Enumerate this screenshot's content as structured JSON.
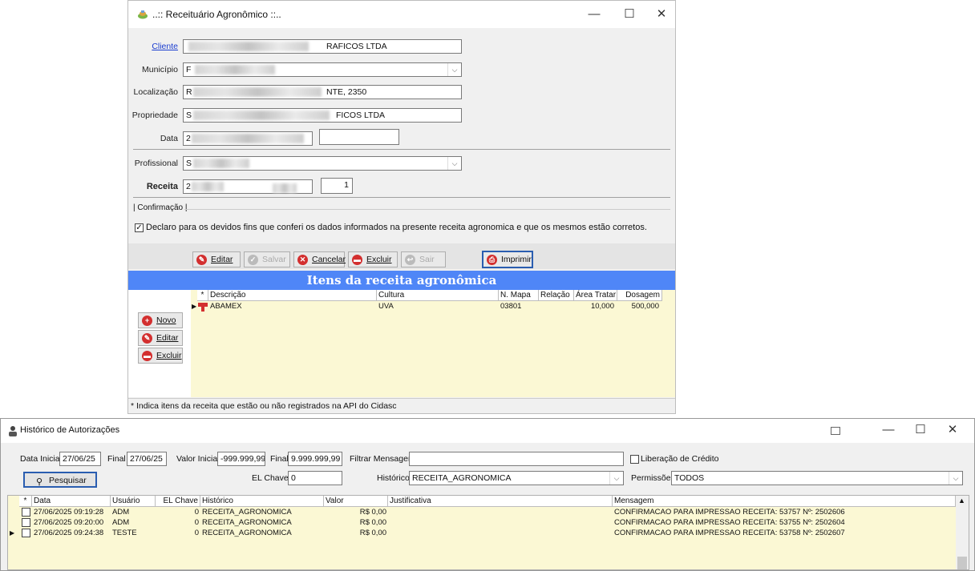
{
  "receituario": {
    "title": "..:: Receituário Agronômico ::..",
    "fields": {
      "cliente_label": "Cliente",
      "cliente_value": "RAFICOS LTDA",
      "municipio_label": "Município",
      "municipio_value": "F",
      "localizacao_label": "Localização",
      "localizacao_value": "NTE, 2350",
      "localizacao_prefix": "R",
      "propriedade_label": "Propriedade",
      "propriedade_value": "FICOS LTDA",
      "propriedade_prefix": "S",
      "data_label": "Data",
      "data_value": "2",
      "profissional_label": "Profissional",
      "profissional_value": "S",
      "receita_label": "Receita",
      "receita_value": "2",
      "receita_num": "1"
    },
    "confirmacao": {
      "group_label": "| Confirmação |",
      "text": "Declaro para os devidos fins que conferi os dados informados na presente receita agronomica e que os mesmos estão corretos."
    },
    "toolbar": {
      "editar": "Editar",
      "salvar": "Salvar",
      "cancelar": "Cancelar",
      "excluir": "Excluir",
      "sair": "Sair",
      "imprimir": "Imprimir"
    },
    "itens_header": "Itens da receita agronômica",
    "side_buttons": {
      "novo": "Novo",
      "editar": "Editar",
      "excluir": "Excluir"
    },
    "items_columns": [
      "*",
      "Descrição",
      "Cultura",
      "N. Mapa",
      "Relação",
      "Área Tratar",
      "Dosagem"
    ],
    "items_rows": [
      {
        "descricao": "ABAMEX",
        "cultura": "UVA",
        "mapa": "03801",
        "relacao": "",
        "area": "10,000",
        "dosagem": "500,000"
      }
    ],
    "footer_note": "* Indica itens da receita que estão ou não registrados na API do Cidasc"
  },
  "historico": {
    "title": "Histórico de Autorizações",
    "filters": {
      "data_inicial_label": "Data Inicial",
      "data_inicial": "27/06/25",
      "final_label": "Final",
      "data_final": "27/06/25",
      "valor_inicial_label": "Valor Inicial",
      "valor_inicial": "-999.999,99",
      "valor_final_label": "Final",
      "valor_final": "9.999.999,99",
      "filtrar_label": "Filtrar Mensagem",
      "filtrar_value": "",
      "liberacao_label": "Liberação de Crédito",
      "pesquisar": "Pesquisar",
      "el_chave_label": "EL Chave",
      "el_chave": "0",
      "historico_label": "Histórico",
      "historico_value": "RECEITA_AGRONOMICA",
      "permissoes_label": "Permissões",
      "permissoes_value": "TODOS"
    },
    "columns": [
      "*",
      "Data",
      "Usuário",
      "EL Chave",
      "Histórico",
      "Valor",
      "Justificativa",
      "Mensagem"
    ],
    "rows": [
      {
        "data": "27/06/2025 09:19:28",
        "usuario": "ADM",
        "el": "0",
        "hist": "RECEITA_AGRONOMICA",
        "valor": "R$ 0,00",
        "just": "",
        "msg": "CONFIRMACAO PARA IMPRESSAO RECEITA: 53757 Nº: 2502606"
      },
      {
        "data": "27/06/2025 09:20:00",
        "usuario": "ADM",
        "el": "0",
        "hist": "RECEITA_AGRONOMICA",
        "valor": "R$ 0,00",
        "just": "",
        "msg": "CONFIRMACAO PARA IMPRESSAO RECEITA: 53755 Nº: 2502604"
      },
      {
        "data": "27/06/2025 09:24:38",
        "usuario": "TESTE",
        "el": "0",
        "hist": "RECEITA_AGRONOMICA",
        "valor": "R$ 0,00",
        "just": "",
        "msg": "CONFIRMACAO PARA IMPRESSAO RECEITA: 53758 Nº: 2502607"
      }
    ]
  },
  "colors": {
    "header_blue": "#4f86f7",
    "grid_yellow": "#fbf8d4"
  }
}
